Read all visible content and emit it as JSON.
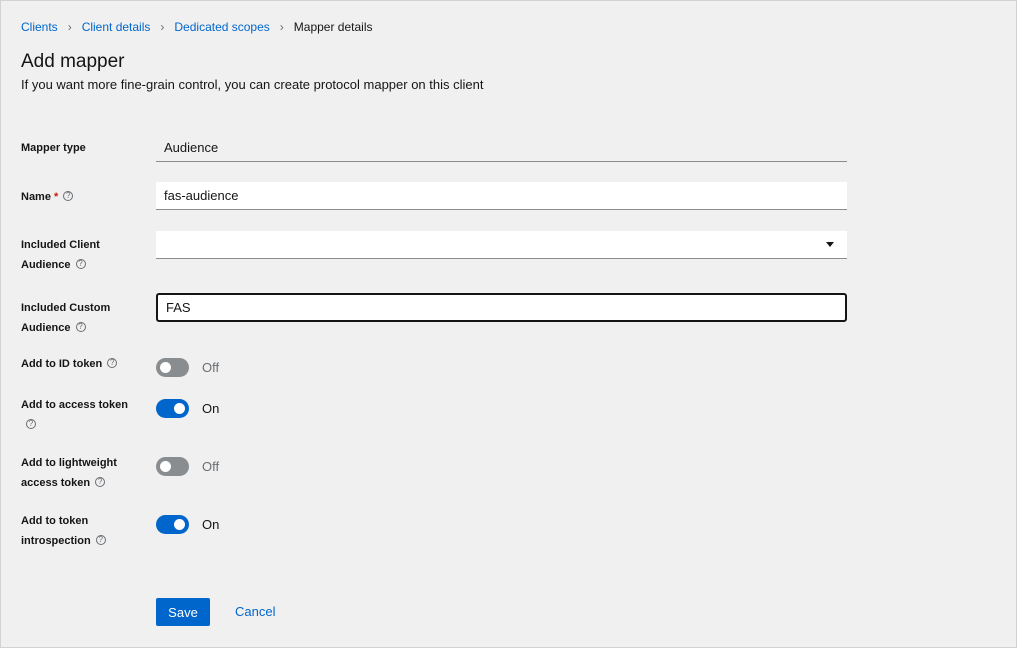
{
  "breadcrumb": {
    "items": [
      "Clients",
      "Client details",
      "Dedicated scopes"
    ],
    "current": "Mapper details",
    "separator": "›"
  },
  "header": {
    "title": "Add mapper",
    "description": "If you want more fine-grain control, you can create protocol mapper on this client"
  },
  "form": {
    "mapper_type": {
      "label": "Mapper type",
      "value": "Audience"
    },
    "name": {
      "label": "Name",
      "required_mark": "*",
      "value": "fas-audience"
    },
    "included_client_audience": {
      "label": "Included Client Audience",
      "value": ""
    },
    "included_custom_audience": {
      "label": "Included Custom Audience",
      "value": "FAS"
    },
    "add_to_id_token": {
      "label": "Add to ID token",
      "state": "Off"
    },
    "add_to_access_token": {
      "label": "Add to access token",
      "state": "On"
    },
    "add_to_lightweight_access_token": {
      "label": "Add to lightweight access token",
      "state": "Off"
    },
    "add_to_token_introspection": {
      "label": "Add to token introspection",
      "state": "On"
    }
  },
  "actions": {
    "save_label": "Save",
    "cancel_label": "Cancel"
  },
  "icons": {
    "help": "help-circle-icon",
    "caret": "caret-down-icon"
  },
  "colors": {
    "primary": "#0066cc",
    "switch_off": "#8a8d90",
    "required": "#c9190b"
  }
}
